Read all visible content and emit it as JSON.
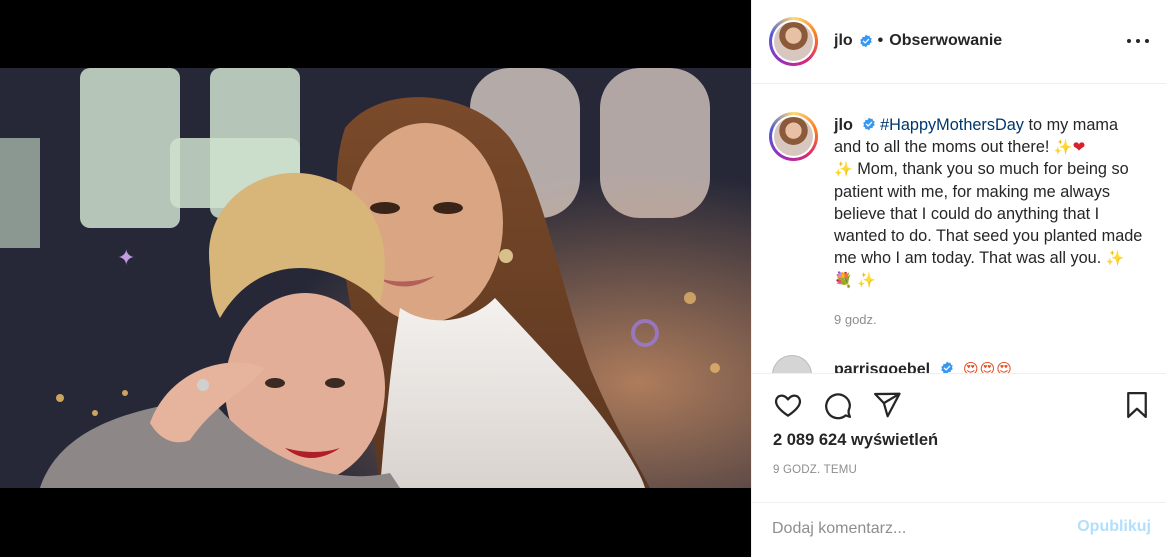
{
  "post": {
    "username": "jlo",
    "verified": true,
    "follow_label": "Obserwowanie",
    "more_icon": "more-options-icon"
  },
  "caption": {
    "username": "jlo",
    "hashtag": "#HappyMothersDay",
    "part1": " to my mama and to all the moms out there! ",
    "part2": " Mom, thank you so much for being so patient with me, for making me always believe that I could do anything that I wanted to do. That seed you planted made me who I am today. That was all you. ",
    "sparkle": "✨",
    "heart": "❤",
    "flower": "💐",
    "time": "9 godz."
  },
  "reply": {
    "username": "parrisgoebel",
    "emojis": "😍😍😍"
  },
  "actions": {
    "like_icon": "heart-icon",
    "comment_icon": "comment-icon",
    "share_icon": "share-icon",
    "save_icon": "bookmark-icon",
    "views": "2 089 624 wyświetleń",
    "time_ago": "9 GODZ. TEMU"
  },
  "comment_box": {
    "placeholder": "Dodaj komentarz...",
    "publish_label": "Opublikuj"
  },
  "colors": {
    "verified": "#3897f0",
    "hashtag": "#00376b",
    "publish_disabled": "#b2dffc",
    "secondary_text": "#8e8e8e"
  }
}
